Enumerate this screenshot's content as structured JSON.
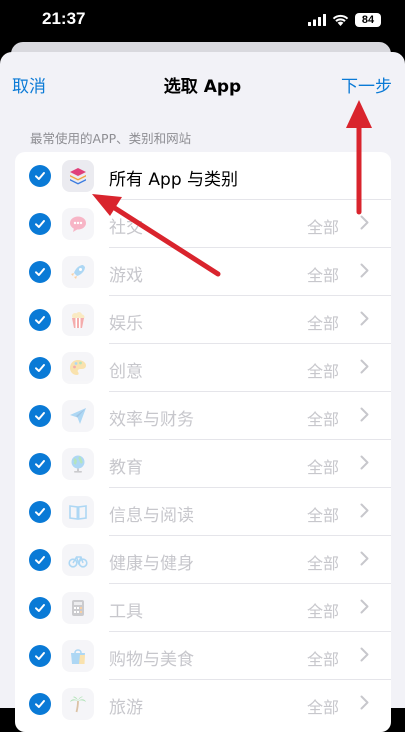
{
  "status_bar": {
    "time": "21:37",
    "battery": "84"
  },
  "nav": {
    "cancel": "取消",
    "title": "选取 App",
    "next": "下一步"
  },
  "section_header": "最常使用的APP、类别和网站",
  "accent_color": "#0a7ad6",
  "annotation_color": "#d9242d",
  "rows": [
    {
      "label": "所有 App 与类别",
      "value": "",
      "icon": "stack-icon",
      "checked": true
    },
    {
      "label": "社交",
      "value": "全部",
      "icon": "chat-bubble-icon",
      "checked": true
    },
    {
      "label": "游戏",
      "value": "全部",
      "icon": "rocket-icon",
      "checked": true
    },
    {
      "label": "娱乐",
      "value": "全部",
      "icon": "popcorn-icon",
      "checked": true
    },
    {
      "label": "创意",
      "value": "全部",
      "icon": "palette-icon",
      "checked": true
    },
    {
      "label": "效率与财务",
      "value": "全部",
      "icon": "paper-plane-icon",
      "checked": true
    },
    {
      "label": "教育",
      "value": "全部",
      "icon": "globe-icon",
      "checked": true
    },
    {
      "label": "信息与阅读",
      "value": "全部",
      "icon": "book-icon",
      "checked": true
    },
    {
      "label": "健康与健身",
      "value": "全部",
      "icon": "bicycle-icon",
      "checked": true
    },
    {
      "label": "工具",
      "value": "全部",
      "icon": "calculator-icon",
      "checked": true
    },
    {
      "label": "购物与美食",
      "value": "全部",
      "icon": "shopping-bag-icon",
      "checked": true
    },
    {
      "label": "旅游",
      "value": "全部",
      "icon": "palm-tree-icon",
      "checked": true
    }
  ]
}
